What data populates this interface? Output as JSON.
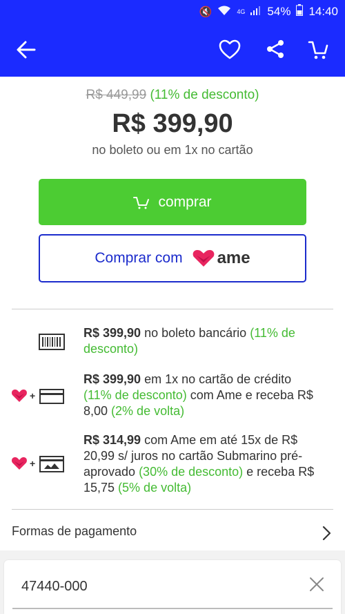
{
  "status_bar": {
    "battery": "54%",
    "time": "14:40",
    "signal_label": "4G"
  },
  "app_bar": {
    "icons": [
      "back-arrow-icon",
      "heart-icon",
      "share-icon",
      "cart-icon"
    ]
  },
  "pricing": {
    "old_price": "R$ 449,99",
    "discount": "(11% de desconto)",
    "price": "R$ 399,90",
    "note": "no boleto ou em 1x no cartão"
  },
  "buttons": {
    "buy_label": "comprar",
    "ame_label": "Comprar com",
    "ame_logo_text": "ame"
  },
  "payment_options": [
    {
      "icon": "barcode-icon",
      "amount": "R$ 399,90",
      "text": " no boleto bancário ",
      "discount": "(11% de desconto)"
    },
    {
      "icon": "ame-plus-card-icon",
      "amount": "R$ 399,90",
      "text": " em 1x no cartão de crédito ",
      "discount": "(11% de desconto)",
      "text2": " com Ame e receba R$ 8,00 ",
      "cashback": "(2% de volta)"
    },
    {
      "icon": "ame-plus-submarino-card-icon",
      "amount": "R$ 314,99",
      "text": " com Ame em até 15x de R$ 20,99 s/ juros no cartão Submarino pré-aprovado  ",
      "discount": "(30% de desconto)",
      "text2": " e receba R$ 15,75 ",
      "cashback": "(5% de volta)"
    }
  ],
  "payment_methods": {
    "label": "Formas de pagamento"
  },
  "cep": {
    "value": "47440-000"
  },
  "colors": {
    "brand_blue": "#1b2bff",
    "buy_green": "#4ccc33",
    "discount_green": "#44bb33",
    "ame_pink": "#e8255f"
  }
}
